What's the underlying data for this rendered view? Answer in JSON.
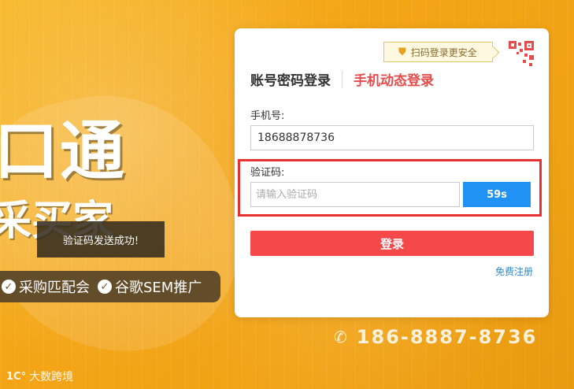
{
  "hero": {
    "title": "口通",
    "subtitle": "采买家",
    "features": [
      {
        "icon": "check-circle-icon",
        "label": "采购匹配会"
      },
      {
        "icon": "check-circle-icon",
        "label": "谷歌SEM推广"
      }
    ],
    "phone": "186-8887-8736",
    "logo_text": "大数跨境"
  },
  "toast": {
    "message": "验证码发送成功!"
  },
  "login": {
    "qr_hint": "扫码登录更安全",
    "tabs": [
      {
        "label": "账号密码登录",
        "active": false
      },
      {
        "label": "手机动态登录",
        "active": true
      }
    ],
    "phone_label": "手机号:",
    "phone_value": "18688878736",
    "code_label": "验证码:",
    "code_placeholder": "请输入验证码",
    "countdown": "59s",
    "submit_label": "登录",
    "register_label": "免费注册"
  },
  "colors": {
    "background": "#f4a516",
    "accent_red": "#f5484a",
    "accent_blue": "#2092f5",
    "highlight": "#e83030"
  }
}
